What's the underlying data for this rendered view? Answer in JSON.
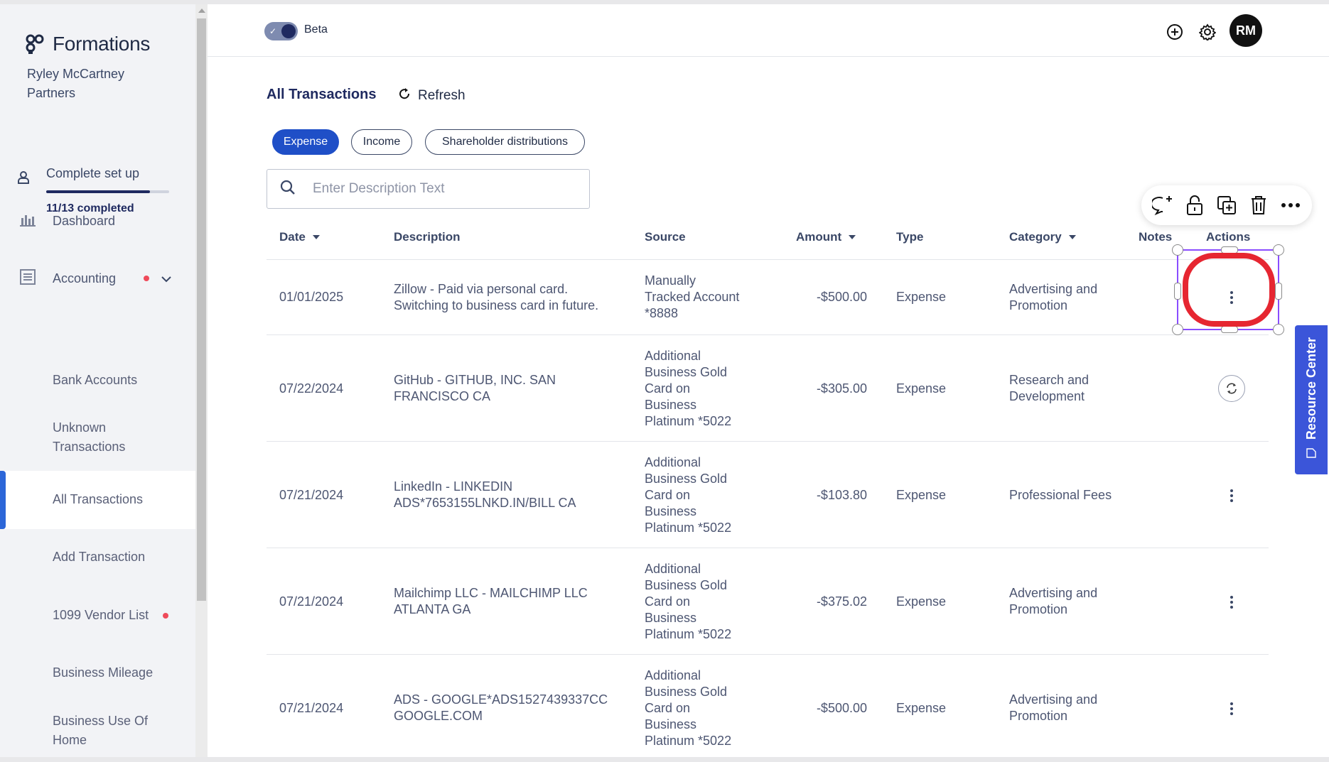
{
  "brand": {
    "name": "Formations",
    "company": "Ryley McCartney Partners"
  },
  "setup": {
    "label": "Complete set up",
    "count": "11/13 completed",
    "progress": 0.846
  },
  "nav": {
    "dashboard": "Dashboard",
    "accounting": "Accounting",
    "sub": [
      {
        "label": "Bank Accounts"
      },
      {
        "label": "Unknown Transactions"
      },
      {
        "label": "All Transactions"
      },
      {
        "label": "Add Transaction"
      },
      {
        "label": "1099 Vendor List"
      },
      {
        "label": "Business Mileage"
      },
      {
        "label": "Business Use Of Home"
      }
    ]
  },
  "topbar": {
    "beta_label": "Beta",
    "avatar_initials": "RM"
  },
  "page": {
    "title": "All Transactions",
    "refresh_label": "Refresh"
  },
  "filters": [
    "Expense",
    "Income",
    "Shareholder distributions"
  ],
  "search": {
    "placeholder": "Enter Description Text",
    "value": ""
  },
  "table": {
    "headers": {
      "date": "Date",
      "description": "Description",
      "source": "Source",
      "amount": "Amount",
      "type": "Type",
      "category": "Category",
      "notes": "Notes",
      "actions": "Actions"
    },
    "rows": [
      {
        "date": "01/01/2025",
        "description": "Zillow - Paid via personal card. Switching to business card in future.",
        "source": "Manually Tracked Account *8888",
        "amount": "-$500.00",
        "type": "Expense",
        "category": "Advertising and Promotion"
      },
      {
        "date": "07/22/2024",
        "description": "GitHub - GITHUB, INC. SAN FRANCISCO CA",
        "source": "Additional Business Gold Card on Business Platinum *5022",
        "amount": "-$305.00",
        "type": "Expense",
        "category": "Research and Development"
      },
      {
        "date": "07/21/2024",
        "description": "LinkedIn - LINKEDIN ADS*7653155LNKD.IN/BILL CA",
        "source": "Additional Business Gold Card on Business Platinum *5022",
        "amount": "-$103.80",
        "type": "Expense",
        "category": "Professional Fees"
      },
      {
        "date": "07/21/2024",
        "description": "Mailchimp LLC - MAILCHIMP LLC ATLANTA GA",
        "source": "Additional Business Gold Card on Business Platinum *5022",
        "amount": "-$375.02",
        "type": "Expense",
        "category": "Advertising and Promotion"
      },
      {
        "date": "07/21/2024",
        "description": "ADS - GOOGLE*ADS1527439337CC GOOGLE.COM",
        "source": "Additional Business Gold Card on Business Platinum *5022",
        "amount": "-$500.00",
        "type": "Expense",
        "category": "Advertising and Promotion"
      }
    ]
  },
  "resource_center": "Resource Center",
  "colors": {
    "primary": "#1f4fc7",
    "active_bar": "#2c66d8",
    "annotation_red": "#e62631",
    "selection": "#8a4dff",
    "dot": "#ef4a5a"
  }
}
